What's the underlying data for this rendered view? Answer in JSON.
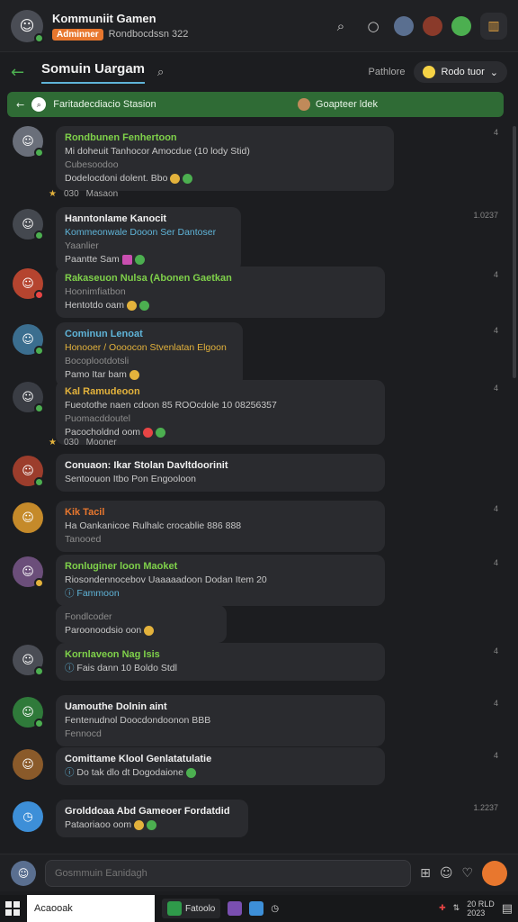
{
  "header": {
    "community_name": "Kommuniit Gamen",
    "role_badge": "Adminner",
    "subtitle": "Rondbocdssn 322",
    "colors": {
      "accent": "#e8772e",
      "green": "#4caf50",
      "blue": "#5fb4d8"
    }
  },
  "channel": {
    "back_icon": "arrow-left-icon",
    "name": "Somuin Uargam",
    "right_label": "Pathlore",
    "pill_label": "Rodo tuor"
  },
  "banner": {
    "text": "Faritadecdiacio Stasion",
    "right_text": "Goapteer ldek"
  },
  "messages": [
    {
      "name": "Rondbunen Fenhertoon",
      "name_color": "#7fd14a",
      "line1": "Mi doheuit Tanhocor Amocdue (10 lody Stid)",
      "line2": "Cubesoodoo",
      "line3": "Dodelocdoni dolent. Bbo",
      "time": "4",
      "avatar_color": "#6a6f7a"
    },
    {
      "name": "Hanntonlame Kanocit",
      "name_color": "#f0f0f0",
      "line1": "Kommeonwale Dooon Ser Dantoser",
      "line2": "Yaanlier",
      "line3": "Paantte Sam",
      "time": "1.0237",
      "avatar_color": "#44484f"
    },
    {
      "name": "Rakaseuon Nulsa (Abonen Gaetkan",
      "name_color": "#7fd14a",
      "line1": "Hoonimfiatbon",
      "line2": "Hentotdo oam",
      "line3": "",
      "time": "4",
      "avatar_color": "#b5442f"
    },
    {
      "name": "Cominun Lenoat",
      "name_color": "#5fb4d8",
      "line1": "Honooer / Oooocon Stvenlatan Elgoon",
      "line2": "Bocoplootdotsli",
      "line3": "Pamo Itar bam",
      "time": "4",
      "avatar_color": "#3b6e8f"
    },
    {
      "name": "Kal Ramudeoon",
      "name_color": "#e3b23c",
      "line1": "Fueotothe naen cdoon 85 ROOcdole 10 08256357",
      "line2": "Puomacddoutel",
      "line3": "Pacocholdnd oom",
      "time": "4",
      "avatar_color": "#3a3d44"
    },
    {
      "name": "Conuaon: Ikar Stolan Davltdoorinit",
      "name_color": "#f0f0f0",
      "line1": "Sentoouon Itbo Pon Engooloon",
      "line2": "",
      "line3": "",
      "time": "",
      "avatar_color": "#9c3d2c"
    },
    {
      "name": "Kik Tacil",
      "name_color": "#e8772e",
      "line1": "Ha Oankanicoe Rulhalc crocablie 886 888",
      "line2": "Tanooed",
      "line3": "",
      "time": "4",
      "avatar_color": "#c58a2a"
    },
    {
      "name": "Ronluginer loon Maoket",
      "name_color": "#7fd14a",
      "line1": "Riosondennocebov Uaaaaadoon Dodan Item 20",
      "line2": "Fammoon",
      "line3": "",
      "time": "4",
      "avatar_color": "#6b4e7a"
    },
    {
      "name": "",
      "name_color": "#f0f0f0",
      "line1": "Fondlcoder",
      "line2": "Paroonoodsio oon",
      "line3": "",
      "time": "",
      "avatar_color": ""
    },
    {
      "name": "Kornlaveon Nag Isis",
      "name_color": "#7fd14a",
      "line1": "Fais dann 10 Boldo Stdl",
      "line2": "",
      "line3": "",
      "time": "4",
      "avatar_color": "#4a4d55"
    },
    {
      "name": "Uamouthe Dolnin aint",
      "name_color": "#f0f0f0",
      "line1": "Fentenudnol Doocdondoonon BBB",
      "line2": "Fennocd",
      "line3": "",
      "time": "4",
      "avatar_color": "#2f7a3a"
    },
    {
      "name": "Comittame Klool Genlatatulatie",
      "name_color": "#f0f0f0",
      "line1": "Do tak dlo dt Dogodaione",
      "line2": "",
      "line3": "",
      "time": "4",
      "avatar_color": "#8a5a2a"
    },
    {
      "name": "Grolddoaa Abd Gameoer Fordatdid",
      "name_color": "#f0f0f0",
      "line1": "Pataoriaoo oom",
      "line2": "",
      "line3": "",
      "time": "1.2237",
      "avatar_color": "#3d8fd8"
    }
  ],
  "reactions": [
    {
      "label": "030",
      "text": "Masaon"
    },
    {
      "label": "030",
      "text": "Mooner"
    }
  ],
  "composer": {
    "placeholder": "Gosmmuin Eanidagh"
  },
  "taskbar": {
    "search_text": "Acaooak",
    "app1_label": "Fatoolo",
    "tray_text": "20 RLD",
    "tray_sub": "2023"
  }
}
